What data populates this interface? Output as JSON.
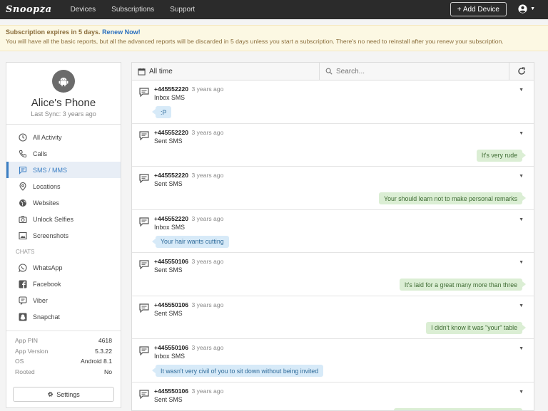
{
  "navbar": {
    "brand": "Snoopza",
    "links": [
      "Devices",
      "Subscriptions",
      "Support"
    ],
    "add_device": "+ Add Device"
  },
  "alert": {
    "title": "Subscription expires in 5 days.",
    "renew": "Renew Now!",
    "body": "You will have all the basic reports, but all the advanced reports will be discarded in 5 days unless you start a subscription. There's no need to reinstall after you renew your subscription."
  },
  "device": {
    "name": "Alice's Phone",
    "last_sync": "Last Sync: 3 years ago"
  },
  "menu": {
    "items": [
      "All Activity",
      "Calls",
      "SMS / MMS",
      "Locations",
      "Websites",
      "Unlock Selfies",
      "Screenshots"
    ],
    "chats_label": "CHATS",
    "chats": [
      "WhatsApp",
      "Facebook",
      "Viber",
      "Snapchat"
    ]
  },
  "info": {
    "rows": [
      {
        "k": "App PIN",
        "v": "4618"
      },
      {
        "k": "App Version",
        "v": "5.3.22"
      },
      {
        "k": "OS",
        "v": "Android 8.1"
      },
      {
        "k": "Rooted",
        "v": "No"
      }
    ],
    "settings": "Settings"
  },
  "toolbar": {
    "filter": "All time",
    "search_placeholder": "Search..."
  },
  "messages": [
    {
      "number": "+445552220",
      "ago": "3 years ago",
      "type": "Inbox SMS",
      "text": ":P",
      "dir": "in"
    },
    {
      "number": "+445552220",
      "ago": "3 years ago",
      "type": "Sent SMS",
      "text": "It's very rude",
      "dir": "out"
    },
    {
      "number": "+445552220",
      "ago": "3 years ago",
      "type": "Sent SMS",
      "text": "Your should learn not to make personal remarks",
      "dir": "out"
    },
    {
      "number": "+445552220",
      "ago": "3 years ago",
      "type": "Inbox SMS",
      "text": "Your hair wants cutting",
      "dir": "in"
    },
    {
      "number": "+445550106",
      "ago": "3 years ago",
      "type": "Sent SMS",
      "text": "It's laid for a great many more than three",
      "dir": "out"
    },
    {
      "number": "+445550106",
      "ago": "3 years ago",
      "type": "Sent SMS",
      "text": "I didn't know it was \"your\" table",
      "dir": "out"
    },
    {
      "number": "+445550106",
      "ago": "3 years ago",
      "type": "Inbox SMS",
      "text": "It wasn't very civil of you to sit down without being invited",
      "dir": "in"
    },
    {
      "number": "+445550106",
      "ago": "3 years ago",
      "type": "Sent SMS",
      "text": "",
      "dir": "out"
    }
  ]
}
